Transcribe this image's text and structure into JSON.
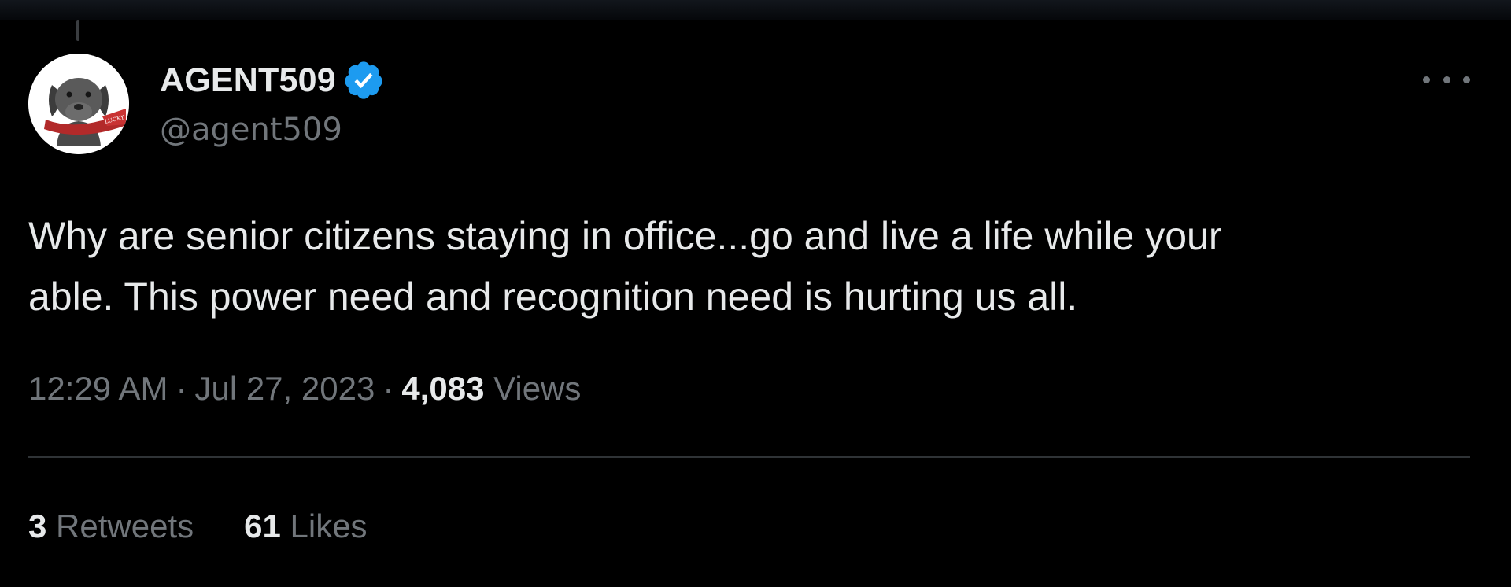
{
  "user": {
    "display_name": "AGENT509",
    "handle": "@agent509",
    "verified": true,
    "avatar_icon": "dog-avatar-icon",
    "avatar_banner_text": "LUCKY"
  },
  "tweet": {
    "text_lines": [
      "Why are senior citizens staying in office...go and live a life while your",
      "able. This power need and recognition need is hurting us all."
    ],
    "time": "12:29 AM",
    "separator": "·",
    "date": "Jul 27, 2023",
    "views_count": "4,083",
    "views_label": "Views"
  },
  "stats": {
    "retweets_count": "3",
    "retweets_label": "Retweets",
    "likes_count": "61",
    "likes_label": "Likes"
  },
  "colors": {
    "background": "#000000",
    "text_primary": "#e7e9ea",
    "text_secondary": "#71767b",
    "divider": "#2f3336",
    "verified_blue": "#1d9bf0"
  }
}
